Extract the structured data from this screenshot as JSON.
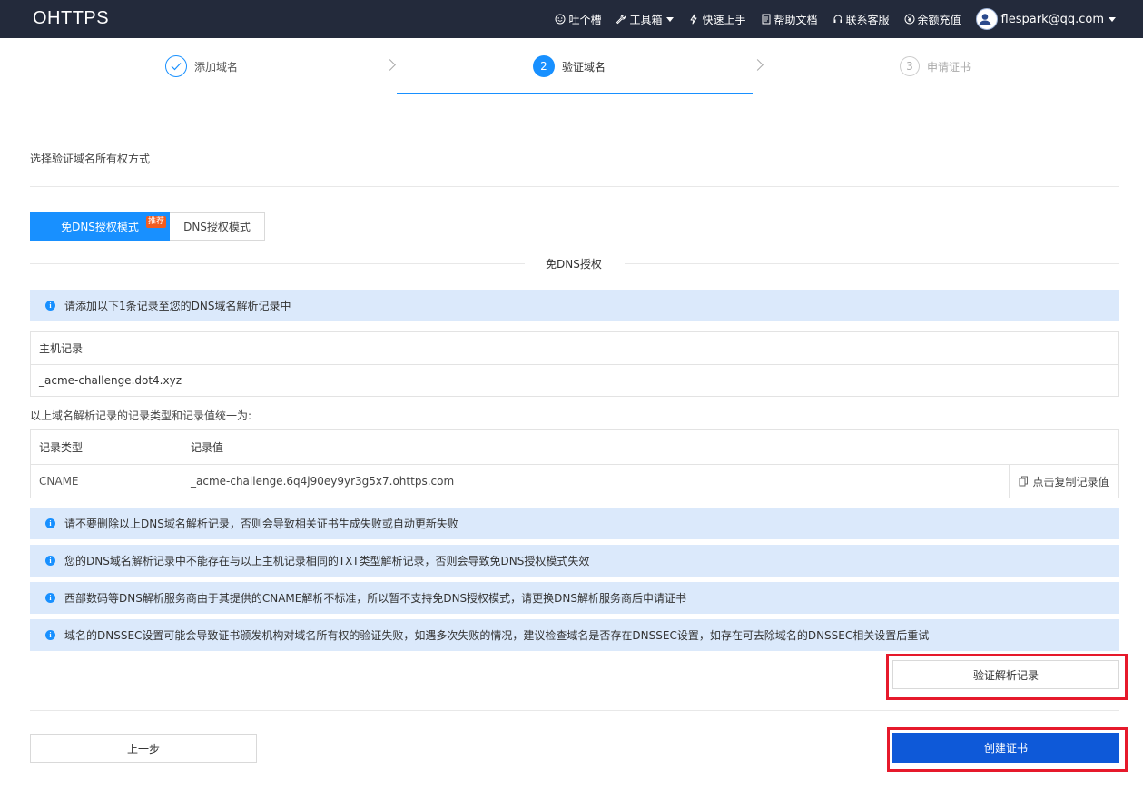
{
  "nav": {
    "brand": "OHTTPS",
    "items": [
      {
        "label": "吐个槽",
        "icon": "smile-icon"
      },
      {
        "label": "工具箱",
        "icon": "wrench-icon",
        "dropdown": true
      },
      {
        "label": "快速上手",
        "icon": "lightning-icon"
      },
      {
        "label": "帮助文档",
        "icon": "document-icon"
      },
      {
        "label": "联系客服",
        "icon": "headset-icon"
      },
      {
        "label": "余额充值",
        "icon": "yen-icon"
      }
    ],
    "user": "flespark@qq.com"
  },
  "steps": [
    {
      "number": "1",
      "label": "添加域名",
      "state": "done"
    },
    {
      "number": "2",
      "label": "验证域名",
      "state": "active"
    },
    {
      "number": "3",
      "label": "申请证书",
      "state": "pending"
    }
  ],
  "section_title": "选择验证域名所有权方式",
  "tabs": {
    "active": "免DNS授权模式",
    "badge": "推荐",
    "inactive": "DNS授权模式"
  },
  "divider_label": "免DNS授权",
  "alerts": {
    "add_record": "请添加以下1条记录至您的DNS域名解析记录中",
    "warnings": [
      "请不要删除以上DNS域名解析记录，否则会导致相关证书生成失败或自动更新失败",
      "您的DNS域名解析记录中不能存在与以上主机记录相同的TXT类型解析记录，否则会导致免DNS授权模式失效",
      "西部数码等DNS解析服务商由于其提供的CNAME解析不标准，所以暂不支持免DNS授权模式，请更换DNS解析服务商后申请证书",
      "域名的DNSSEC设置可能会导致证书颁发机构对域名所有权的验证失败，如遇多次失败的情况，建议检查域名是否存在DNSSEC设置，如存在可去除域名的DNSSEC相关设置后重试"
    ]
  },
  "host": {
    "header": "主机记录",
    "value": "_acme-challenge.dot4.xyz"
  },
  "note": "以上域名解析记录的记录类型和记录值统一为:",
  "record": {
    "type_header": "记录类型",
    "value_header": "记录值",
    "type": "CNAME",
    "value": "_acme-challenge.6q4j90ey9yr3g5x7.ohttps.com",
    "copy_label": "点击复制记录值"
  },
  "buttons": {
    "verify": "验证解析记录",
    "prev": "上一步",
    "create": "创建证书"
  },
  "colors": {
    "nav_bg": "#232a3b",
    "primary": "#1890ff",
    "alert_bg": "#dbe9fb",
    "create_btn": "#0e59d8",
    "badge": "#f25c1f",
    "highlight": "#e6192b"
  }
}
